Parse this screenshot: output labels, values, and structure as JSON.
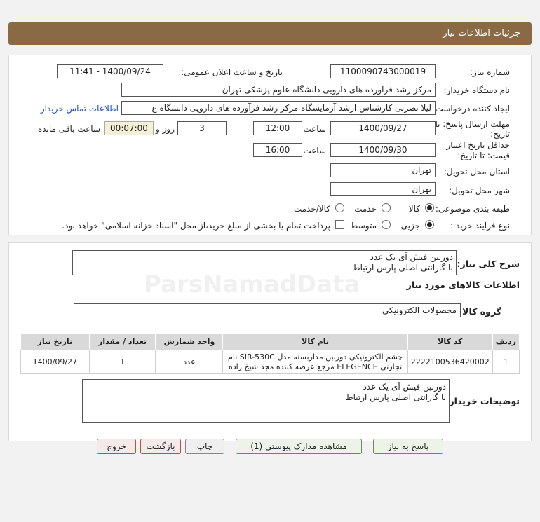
{
  "page": {
    "title": "جزئیات اطلاعات نیاز"
  },
  "need": {
    "number_label": "شماره نیاز:",
    "number": "1100090743000019",
    "announce_label": "تاریخ و ساعت اعلان عمومی:",
    "announce_value": "1400/09/24 - 11:41",
    "buyer_label": "نام دستگاه خریدار:",
    "buyer": "مرکز رشد فرآورده های دارویی دانشگاه علوم پزشکی تهران",
    "creator_label": "ایجاد کننده درخواست:",
    "creator": "لیلا نصرتی کارشناس ارشد آزمایشگاه مرکز رشد فرآورده های دارویی دانشگاه ع",
    "contact_link": "اطلاعات تماس خریدار",
    "deadline_label_1": "مهلت ارسال پاسخ: تا",
    "deadline_label_2": "تاریخ:",
    "deadline_date": "1400/09/27",
    "time_label": "ساعت",
    "deadline_time": "12:00",
    "days": "3",
    "days_label": "روز و",
    "remaining": "00:07:00",
    "remaining_label": "ساعت باقی مانده",
    "validity_label_1": "حداقل تاریخ اعتبار",
    "validity_label_2": "قیمت: تا تاریخ:",
    "validity_date": "1400/09/30",
    "validity_time_label": "ساعت",
    "validity_time": "16:00",
    "province_label": "استان محل تحویل:",
    "province": "تهران",
    "city_label": "شهر محل تحویل:",
    "city": "تهران",
    "category_label": "طبقه بندی موضوعی:",
    "category_options": [
      "کالا",
      "خدمت",
      "کالا/خدمت"
    ],
    "category_selected": "کالا",
    "process_label": "نوع فرآیند خرید :",
    "process_options": [
      "جزیی",
      "متوسط"
    ],
    "process_selected": "جزیی",
    "payment_note": "پرداخت تمام یا بخشی از مبلغ خرید،از محل \"اسناد خزانه اسلامی\" خواهد بود."
  },
  "details": {
    "summary_label": "شرح کلی نیاز:",
    "summary_line1": "دوربین فیش آی یک عدد",
    "summary_line2": "با گارانتی اصلی پارس ارتباط",
    "goods_info_title": "اطلاعات کالاهای مورد نیاز",
    "goods_group_label": "گروه کالا:",
    "goods_group": "محصولات الکترونیکی",
    "table": {
      "headers": [
        "ردیف",
        "کد کالا",
        "نام کالا",
        "واحد شمارش",
        "تعداد / مقدار",
        "تاریخ نیاز"
      ],
      "rows": [
        {
          "row": "1",
          "code": "2222100536420002",
          "name_line1": "چشم الکترونیکی دوربین مداربسته مدل SIR-530C نام",
          "name_line2": "تجارتی ELEGENCE مرجع عرضه کننده مجد شیخ زاده",
          "unit": "عدد",
          "qty": "1",
          "date": "1400/09/27"
        }
      ]
    },
    "buyer_notes_label": "توضیحات خریدار:",
    "buyer_notes_line1": "دوربین فیش آی یک عدد",
    "buyer_notes_line2": "با گارانتی اصلی پارس ارتباط"
  },
  "buttons": {
    "reply": "پاسخ به نیاز",
    "attachments": "مشاهده مدارک پیوستی (1)",
    "print": "چاپ",
    "back": "بازگشت",
    "exit": "خروج"
  },
  "watermark": {
    "brand": "ParsNamadData"
  },
  "colors": {
    "header": "#8a6a45",
    "link": "#1e4fbf",
    "remaining_bg": "#f4efd6"
  }
}
